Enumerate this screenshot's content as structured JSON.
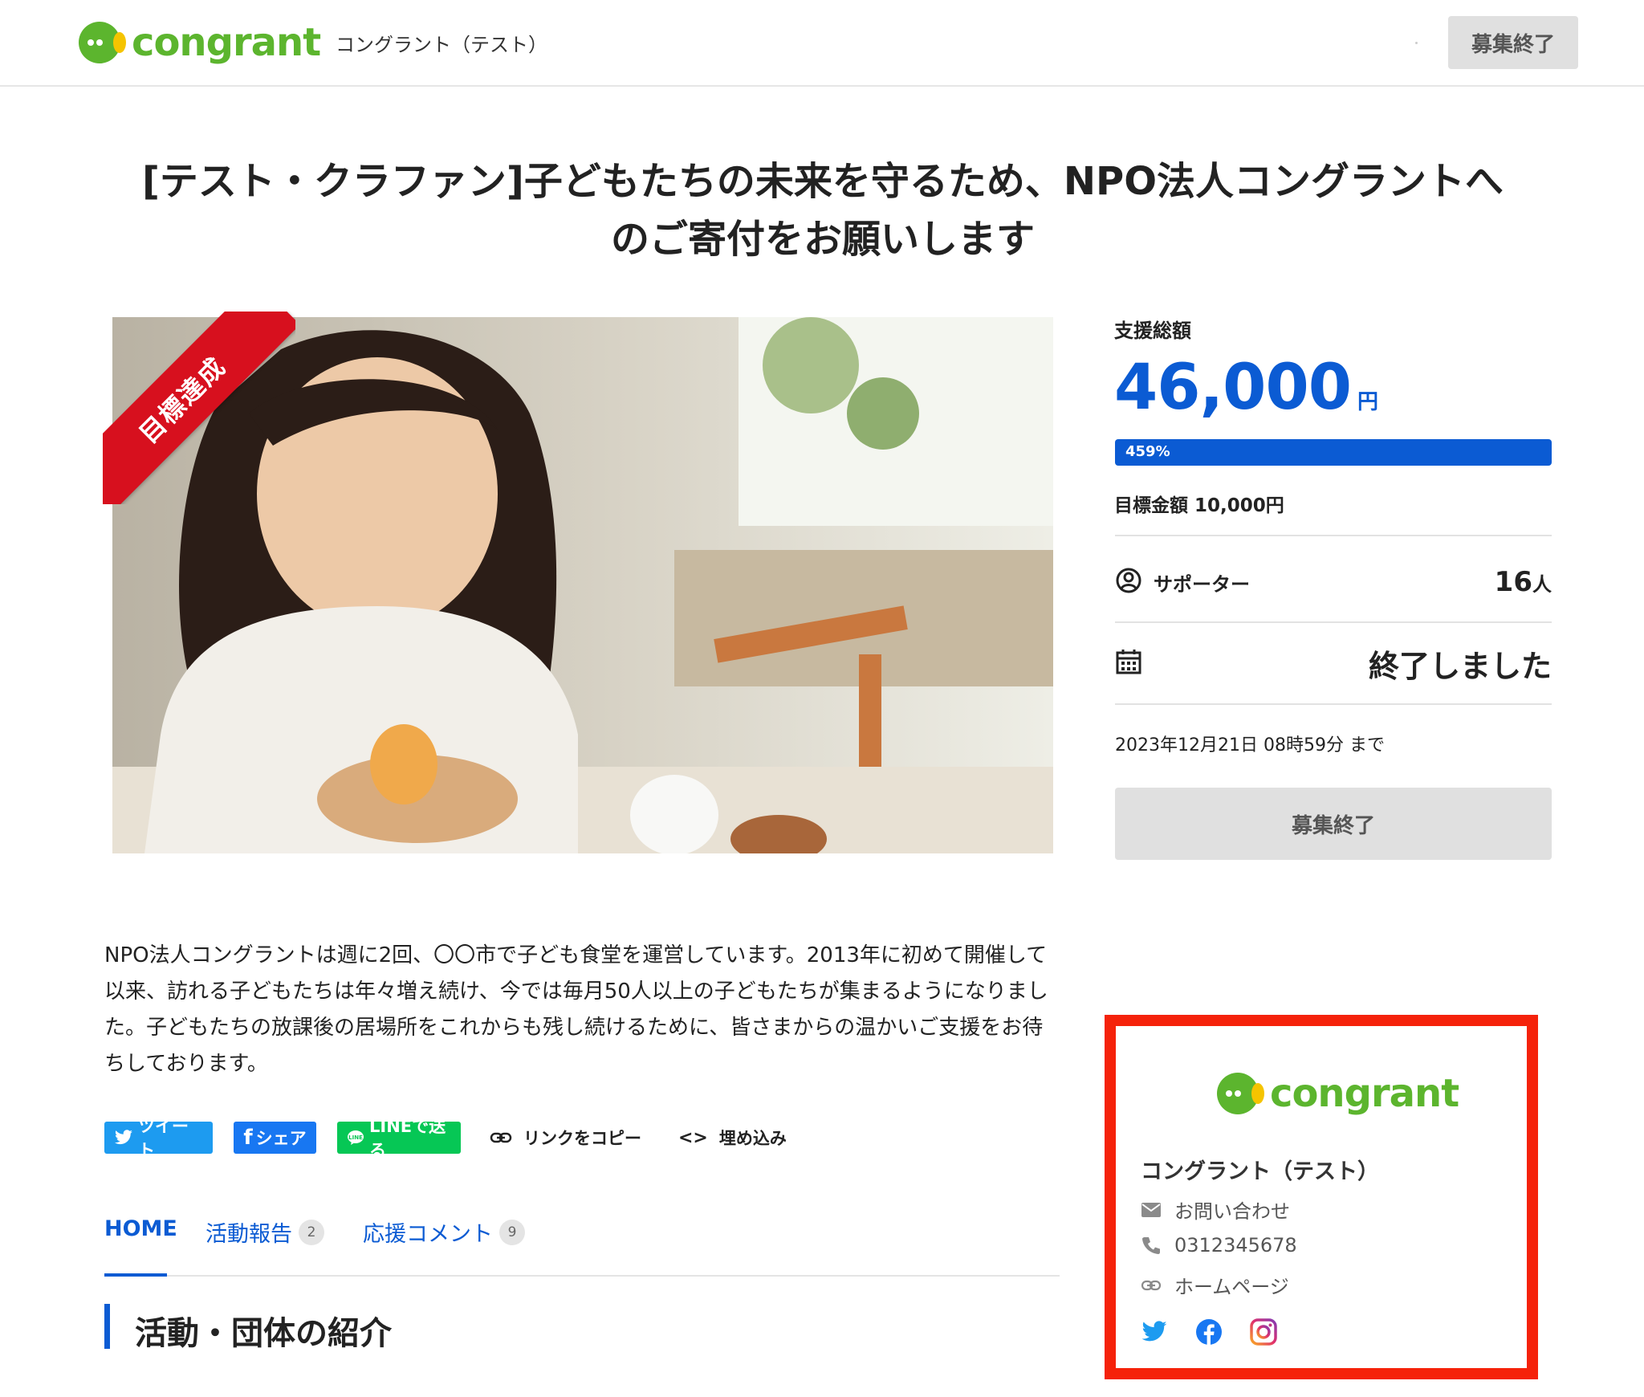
{
  "header": {
    "logo_text": "congrant",
    "org_name": "コングラント（テスト）",
    "status_button": "募集終了"
  },
  "project": {
    "title_line1": "[テスト・クラファン]子どもたちの未来を守るため、NPO法人コングラントへ",
    "title_line2": "のご寄付をお願いします",
    "badge": "目標達成"
  },
  "funding": {
    "total_label": "支援総額",
    "amount": "46,000",
    "amount_unit": "円",
    "progress_text": "459%",
    "progress_fill_percent": 100,
    "goal": "目標金額 10,000円",
    "supporters_label": "サポーター",
    "supporters_count": "16",
    "supporters_unit": "人",
    "end_status": "終了しました",
    "deadline": "2023年12月21日 08時59分 まで",
    "button": "募集終了"
  },
  "description": "NPO法人コングラントは週に2回、〇〇市で子ども食堂を運営しています。2013年に初めて開催して以来、訪れる子どもたちは年々増え続け、今では毎月50人以上の子どもたちが集まるようになりました。子どもたちの放課後の居場所をこれからも残し続けるために、皆さまからの温かいご支援をお待ちしております。",
  "share": {
    "tweet": "ツイート",
    "facebook": "シェア",
    "line": "LINEで送る",
    "copy_link": "リンクをコピー",
    "embed": "埋め込み"
  },
  "tabs": [
    {
      "label": "HOME"
    },
    {
      "label": "活動報告",
      "count": "2"
    },
    {
      "label": "応援コメント",
      "count": "9"
    }
  ],
  "section_heading": "活動・団体の紹介",
  "org_card": {
    "logo_text": "congrant",
    "name": "コングラント（テスト）",
    "contact": "お問い合わせ",
    "phone": "0312345678",
    "homepage": "ホームページ"
  },
  "colors": {
    "brand_green": "#5cb52e",
    "brand_yellow": "#f5c400",
    "accent_blue": "#0b5bd3",
    "ribbon_red": "#d7101e",
    "highlight_red": "#f5220a"
  }
}
